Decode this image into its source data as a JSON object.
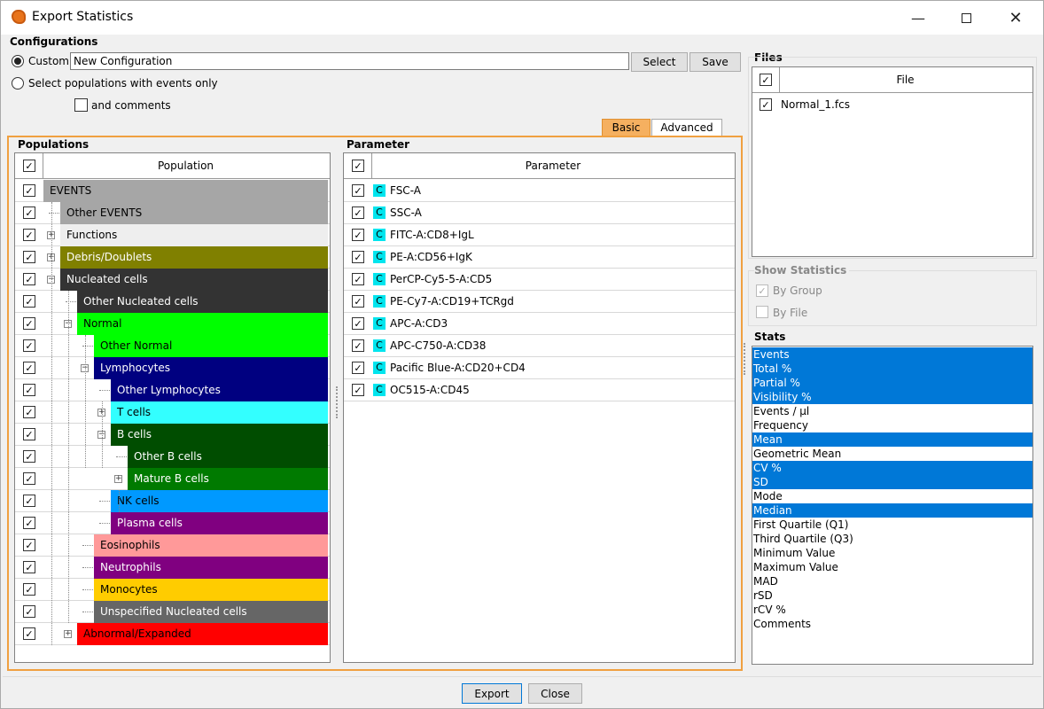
{
  "window": {
    "title": "Export Statistics"
  },
  "config": {
    "heading": "Configurations",
    "custom_label": "Custom",
    "config_name": "New Configuration",
    "select_button": "Select",
    "save_button": "Save",
    "events_only_label": "Select populations with events only",
    "comments_label": "and comments"
  },
  "tabs": {
    "basic": "Basic",
    "advanced": "Advanced"
  },
  "populations": {
    "heading": "Populations",
    "column": "Population",
    "rows": [
      {
        "label": "EVENTS",
        "bg": "#a6a6a6",
        "fg": "#000000"
      },
      {
        "label": "Other EVENTS",
        "bg": "#a6a6a6",
        "fg": "#000000"
      },
      {
        "label": "Functions",
        "bg": "#eeeeee",
        "fg": "#000000"
      },
      {
        "label": "Debris/Doublets",
        "bg": "#808000",
        "fg": "#ffffff"
      },
      {
        "label": "Nucleated cells",
        "bg": "#333333",
        "fg": "#ffffff"
      },
      {
        "label": "Other Nucleated cells",
        "bg": "#333333",
        "fg": "#ffffff"
      },
      {
        "label": "Normal",
        "bg": "#00ff00",
        "fg": "#000000"
      },
      {
        "label": "Other Normal",
        "bg": "#00ff00",
        "fg": "#000000"
      },
      {
        "label": "Lymphocytes",
        "bg": "#000080",
        "fg": "#ffffff"
      },
      {
        "label": "Other Lymphocytes",
        "bg": "#000080",
        "fg": "#ffffff"
      },
      {
        "label": "T cells",
        "bg": "#33ffff",
        "fg": "#000000"
      },
      {
        "label": "B cells",
        "bg": "#004d00",
        "fg": "#ffffff"
      },
      {
        "label": "Other B cells",
        "bg": "#004d00",
        "fg": "#ffffff"
      },
      {
        "label": "Mature B cells",
        "bg": "#007a00",
        "fg": "#ffffff"
      },
      {
        "label": "NK cells",
        "bg": "#0099ff",
        "fg": "#000000"
      },
      {
        "label": "Plasma cells",
        "bg": "#800080",
        "fg": "#ffffff"
      },
      {
        "label": "Eosinophils",
        "bg": "#ff9999",
        "fg": "#000000"
      },
      {
        "label": "Neutrophils",
        "bg": "#800080",
        "fg": "#ffffff"
      },
      {
        "label": "Monocytes",
        "bg": "#ffcc00",
        "fg": "#000000"
      },
      {
        "label": "Unspecified Nucleated cells",
        "bg": "#666666",
        "fg": "#ffffff"
      },
      {
        "label": "Abnormal/Expanded",
        "bg": "#ff0000",
        "fg": "#000000"
      }
    ]
  },
  "parameters": {
    "heading": "Parameter",
    "column": "Parameter",
    "badge": "C",
    "rows": [
      "FSC-A",
      "SSC-A",
      "FITC-A:CD8+IgL",
      "PE-A:CD56+IgK",
      "PerCP-Cy5-5-A:CD5",
      "PE-Cy7-A:CD19+TCRgd",
      "APC-A:CD3",
      "APC-C750-A:CD38",
      "Pacific Blue-A:CD20+CD4",
      "OC515-A:CD45"
    ]
  },
  "files": {
    "heading": "Files",
    "column": "File",
    "rows": [
      "Normal_1.fcs"
    ]
  },
  "show_statistics": {
    "heading": "Show Statistics",
    "by_group": "By Group",
    "by_file": "By File"
  },
  "stats": {
    "heading": "Stats",
    "items": [
      {
        "label": "Events",
        "selected": true
      },
      {
        "label": "Total %",
        "selected": true
      },
      {
        "label": "Partial %",
        "selected": true
      },
      {
        "label": "Visibility %",
        "selected": true
      },
      {
        "label": "Events / µl",
        "selected": false
      },
      {
        "label": "Frequency",
        "selected": false
      },
      {
        "label": "Mean",
        "selected": true
      },
      {
        "label": "Geometric Mean",
        "selected": false
      },
      {
        "label": "CV %",
        "selected": true
      },
      {
        "label": "SD",
        "selected": true
      },
      {
        "label": "Mode",
        "selected": false
      },
      {
        "label": "Median",
        "selected": true
      },
      {
        "label": "First Quartile (Q1)",
        "selected": false
      },
      {
        "label": "Third Quartile (Q3)",
        "selected": false
      },
      {
        "label": "Minimum Value",
        "selected": false
      },
      {
        "label": "Maximum Value",
        "selected": false
      },
      {
        "label": "MAD",
        "selected": false
      },
      {
        "label": "rSD",
        "selected": false
      },
      {
        "label": "rCV %",
        "selected": false
      },
      {
        "label": "Comments",
        "selected": false
      }
    ]
  },
  "footer": {
    "export_button": "Export",
    "close_button": "Close"
  },
  "colors": {
    "accent": "#0078d7",
    "tab_active": "#f5b060",
    "frame": "#f0a040"
  }
}
